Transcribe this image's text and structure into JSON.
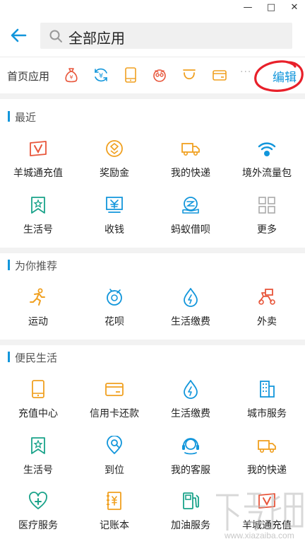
{
  "window_controls": {
    "minimize": "—",
    "maximize": "□",
    "close": "✕"
  },
  "header": {
    "back_icon": "arrow-left-icon",
    "search_icon": "search-icon",
    "search_text": "全部应用"
  },
  "home_apps": {
    "label": "首页应用",
    "icons": [
      "moneybag-icon",
      "yuan-refresh-icon",
      "phone-icon",
      "face-icon",
      "smile-box-icon",
      "card-icon"
    ],
    "more": "···",
    "edit_label": "编辑"
  },
  "sections": {
    "recent": {
      "title": "最近",
      "items": [
        {
          "label": "羊城通充值",
          "icon": "yct-card-icon"
        },
        {
          "label": "奖励金",
          "icon": "reward-icon"
        },
        {
          "label": "我的快递",
          "icon": "truck-icon"
        },
        {
          "label": "境外流量包",
          "icon": "wifi-globe-icon"
        },
        {
          "label": "生活号",
          "icon": "bookmark-star-icon"
        },
        {
          "label": "收钱",
          "icon": "receive-money-icon"
        },
        {
          "label": "蚂蚁借呗",
          "icon": "ant-loan-icon"
        },
        {
          "label": "更多",
          "icon": "grid-more-icon"
        }
      ]
    },
    "recommend": {
      "title": "为你推荐",
      "items": [
        {
          "label": "运动",
          "icon": "running-icon"
        },
        {
          "label": "花呗",
          "icon": "huabei-icon"
        },
        {
          "label": "生活缴费",
          "icon": "water-drop-icon"
        },
        {
          "label": "外卖",
          "icon": "scooter-icon"
        }
      ]
    },
    "convenience": {
      "title": "便民生活",
      "items": [
        {
          "label": "充值中心",
          "icon": "phone-icon"
        },
        {
          "label": "信用卡还款",
          "icon": "credit-card-icon"
        },
        {
          "label": "生活缴费",
          "icon": "water-drop-icon"
        },
        {
          "label": "城市服务",
          "icon": "building-icon"
        },
        {
          "label": "生活号",
          "icon": "bookmark-star-icon"
        },
        {
          "label": "到位",
          "icon": "location-pin-icon"
        },
        {
          "label": "我的客服",
          "icon": "headset-icon"
        },
        {
          "label": "我的快递",
          "icon": "truck-icon"
        },
        {
          "label": "医疗服务",
          "icon": "medical-icon"
        },
        {
          "label": "记账本",
          "icon": "ledger-icon"
        },
        {
          "label": "加油服务",
          "icon": "gas-pump-icon"
        },
        {
          "label": "羊城通充值",
          "icon": "yct-card-icon"
        }
      ]
    }
  },
  "watermark": {
    "text": "www.xiazaiba.com"
  }
}
